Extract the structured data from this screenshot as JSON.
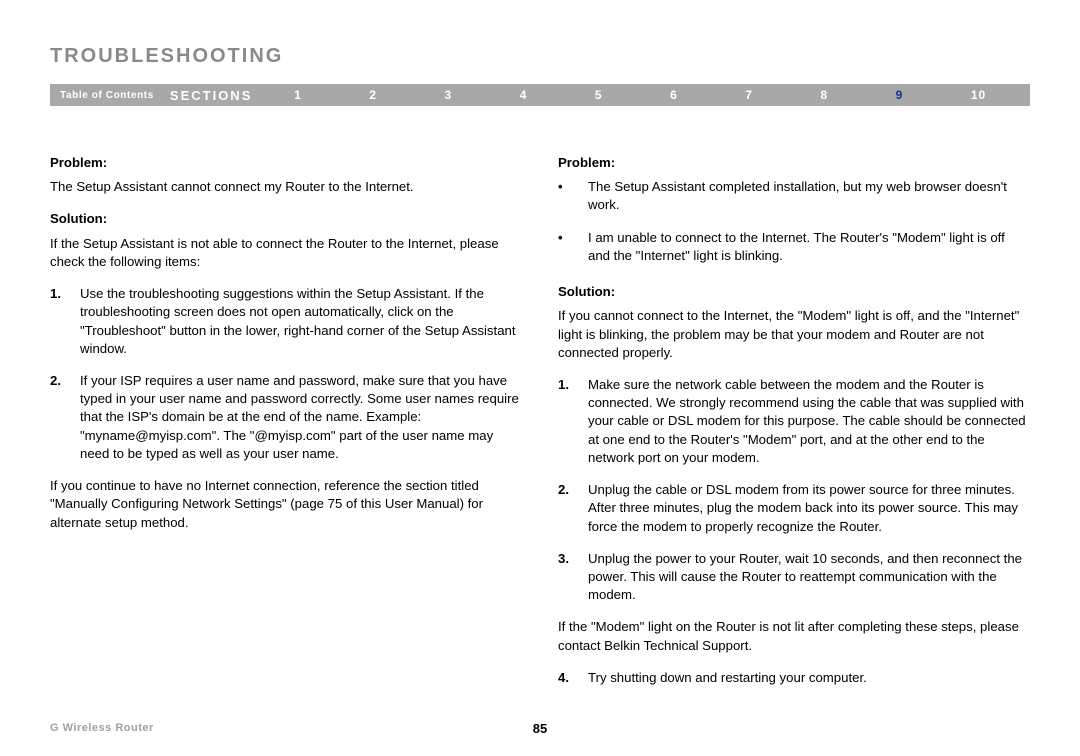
{
  "title": "TROUBLESHOOTING",
  "nav": {
    "toc": "Table of Contents",
    "sections_label": "SECTIONS",
    "numbers": [
      "1",
      "2",
      "3",
      "4",
      "5",
      "6",
      "7",
      "8",
      "9",
      "10"
    ],
    "active_index": 8
  },
  "left": {
    "problem_label": "Problem:",
    "problem_text": "The Setup Assistant cannot connect my Router to the Internet.",
    "solution_label": "Solution:",
    "solution_intro": "If the Setup Assistant is not able to connect the Router to the Internet, please check the following items:",
    "steps": [
      "Use the troubleshooting suggestions within the Setup Assistant. If the troubleshooting screen does not open automatically, click on the \"Troubleshoot\" button in the lower, right-hand corner of the Setup Assistant window.",
      "If your ISP requires a user name and password, make sure that you have typed in your user name and password correctly. Some user names require that the ISP's domain be at the end of the name. Example: \"myname@myisp.com\". The \"@myisp.com\" part of the user name may need to be typed as well as your user name."
    ],
    "after": "If you continue to have no Internet connection, reference the section titled \"Manually Configuring Network Settings\" (page 75 of this User Manual) for alternate setup method."
  },
  "right": {
    "problem_label": "Problem:",
    "problem_bullets": [
      "The Setup Assistant completed installation, but my web browser doesn't work.",
      "I am unable to connect to the Internet. The Router's \"Modem\" light is off and the \"Internet\" light is blinking."
    ],
    "solution_label": "Solution:",
    "solution_intro": "If you cannot connect to the Internet, the \"Modem\" light is off, and the \"Internet\" light is blinking, the problem may be that your modem and Router are not connected properly.",
    "steps": [
      "Make sure the network cable between the modem and the Router is connected. We strongly recommend using the cable that was supplied with your cable or DSL modem for this purpose. The cable should be connected at one end to the Router's \"Modem\" port, and at the other end to the network port on your modem.",
      "Unplug the cable or DSL modem from its power source for three minutes. After three minutes, plug the modem back into its power source. This may force the modem to properly recognize the Router.",
      "Unplug the power to your Router, wait 10 seconds, and then reconnect the power. This will cause the Router to reattempt communication with the modem."
    ],
    "interject": "If the \"Modem\" light on the Router is not lit after completing these steps, please contact Belkin Technical Support.",
    "steps2": [
      "Try shutting down and restarting your computer."
    ]
  },
  "footer": {
    "product": "G Wireless Router",
    "page": "85"
  }
}
